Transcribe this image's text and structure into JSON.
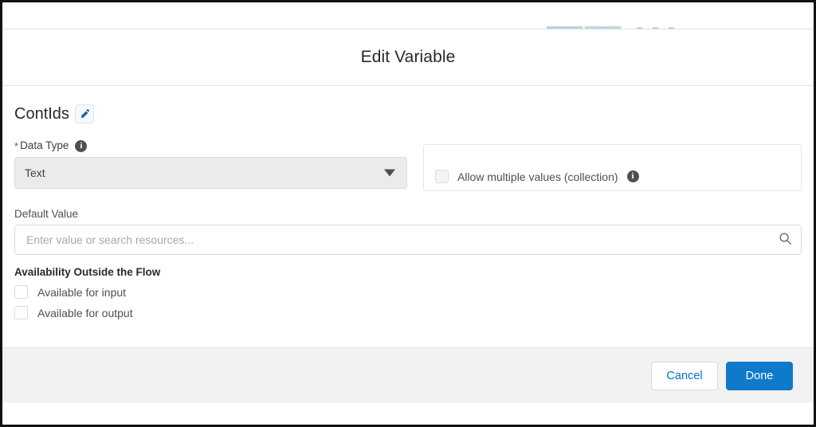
{
  "window": {
    "title": "Edit Variable"
  },
  "variable": {
    "name": "ContIds",
    "edit_icon": "pencil-icon",
    "edit_button_title": "Edit name"
  },
  "data_type": {
    "required_marker": "*",
    "label": "Data Type",
    "info_icon": "info-icon",
    "info_glyph": "i",
    "selected_value": "Text",
    "options": [
      "Text"
    ],
    "caret_icon": "chevron-down-icon",
    "disabled": true
  },
  "collection": {
    "checkbox_label": "Allow multiple values (collection)",
    "checked": false,
    "info_icon": "info-icon",
    "info_glyph": "i"
  },
  "default_value": {
    "label": "Default Value",
    "value": "",
    "placeholder": "Enter value or search resources...",
    "search_icon": "search-icon"
  },
  "availability": {
    "title": "Availability Outside the Flow",
    "options": [
      {
        "label": "Available for input",
        "checked": false
      },
      {
        "label": "Available for output",
        "checked": false
      }
    ]
  },
  "footer": {
    "cancel_label": "Cancel",
    "done_label": "Done"
  },
  "colors": {
    "brand_blue": "#0f7ac9",
    "link_blue": "#0070d2",
    "required_red": "#c23934",
    "text_dark": "#2b2826",
    "text_body": "#3e3e3c",
    "text_muted": "#514f4d",
    "border": "#dddbda",
    "footer_bg": "#f3f2f2",
    "disabled_bg": "#ecebea"
  }
}
